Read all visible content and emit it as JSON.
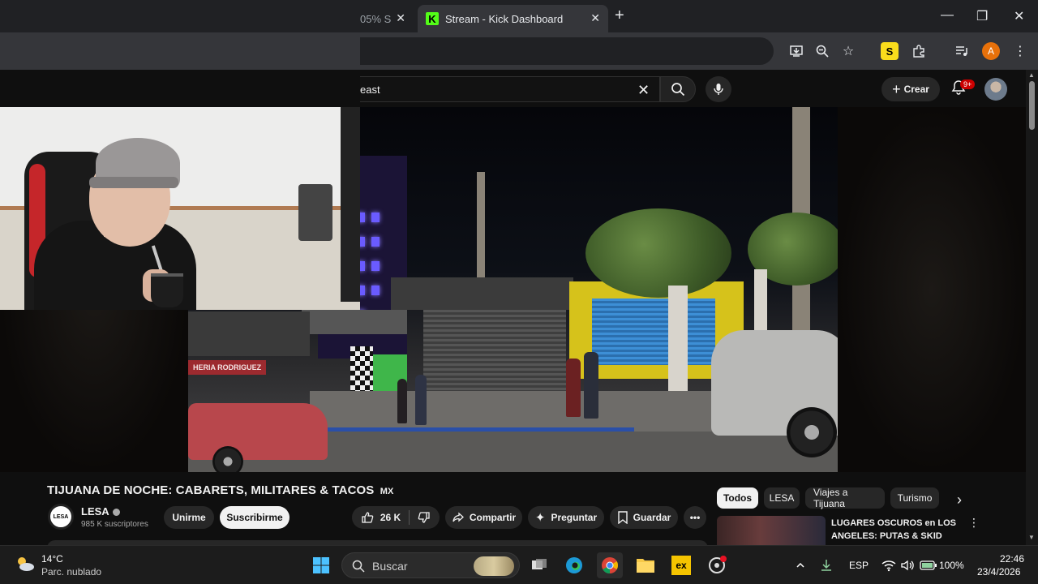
{
  "browser": {
    "tabs": [
      {
        "title": "05% S",
        "active": false
      },
      {
        "title": "Stream - Kick Dashboard",
        "active": true
      }
    ],
    "kick_logo_letter": "K",
    "profile_letter": "A",
    "extension_letter": "S",
    "icons": [
      "install-app-icon",
      "zoom-icon",
      "bookmark-star-icon",
      "extension-icon",
      "puzzle-icon",
      "media-control-icon",
      "profile-icon",
      "more-menu-icon"
    ]
  },
  "youtube": {
    "search_query": "east",
    "create_label": "Crear",
    "notification_badge": "9+",
    "video": {
      "title": "TIJUANA DE NOCHE: CABARETS, MILITARES & TACOS",
      "title_suffix": "MX",
      "store_sign": "HERIA RODRIGUEZ",
      "channel": {
        "name": "LESA",
        "avatar_text": "LESA",
        "subscribers": "985 K suscriptores"
      },
      "actions": {
        "join": "Unirme",
        "subscribe": "Suscribirme",
        "likes": "26 K",
        "share": "Compartir",
        "ask": "Preguntar",
        "save": "Guardar"
      }
    },
    "chips": [
      "Todos",
      "LESA",
      "Viajes a Tijuana",
      "Turismo"
    ],
    "recommended": {
      "title": "LUGARES OSCUROS en LOS ANGELES: PUTAS & SKID ROW"
    }
  },
  "taskbar": {
    "weather_temp": "14°C",
    "weather_desc": "Parc. nublado",
    "search_placeholder": "Buscar",
    "extra_app_label": "ex",
    "language": "ESP",
    "battery": "100%",
    "time": "22:46",
    "date": "23/4/2026"
  },
  "colors": {
    "kick_green": "#53fc18",
    "yt_background": "#0f0f0f",
    "badge_red": "#cc0000"
  }
}
